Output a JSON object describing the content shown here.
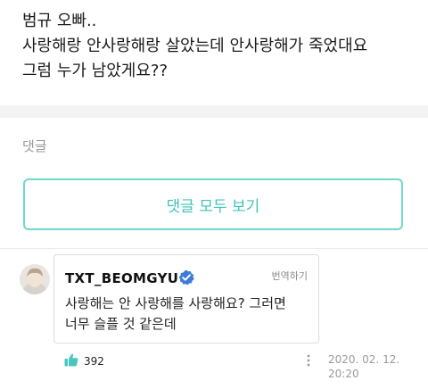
{
  "post": {
    "lines": [
      "범규 오빠..",
      "사랑해랑 안사랑해랑 살았는데 안사랑해가 죽었대요",
      "그럼 누가 남았게요??"
    ]
  },
  "comments": {
    "label": "댓글",
    "view_all_label": "댓글 모두 보기"
  },
  "reply": {
    "author": "TXT_BEOMGYU",
    "verified_icon": "verified-badge-icon",
    "translate_label": "번역하기",
    "text_lines": [
      "사랑해는 안 사랑해를 사랑해요? 그러면",
      "너무 슬플 것 같은데"
    ],
    "like_icon": "thumbs-up-icon",
    "like_count": "392",
    "more_icon": "more-horizontal-icon",
    "date": "2020. 02. 12.",
    "time": "20:20"
  },
  "colors": {
    "accent": "#3fc3b9",
    "verified": "#3e7bd9",
    "like": "#49c7bd"
  }
}
